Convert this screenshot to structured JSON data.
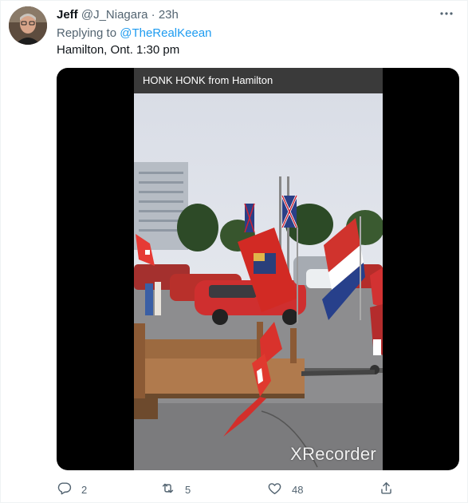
{
  "tweet": {
    "display_name": "Jeff",
    "handle": "@J_Niagara",
    "separator": "·",
    "time": "23h",
    "replying_prefix": "Replying to",
    "replying_to": "@TheRealKeean",
    "text": "Hamilton, Ont. 1:30 pm"
  },
  "media": {
    "video_title": "HONK HONK from Hamilton",
    "watermark": "XRecorder"
  },
  "actions": {
    "replies": "2",
    "retweets": "5",
    "likes": "48"
  },
  "colors": {
    "link": "#1d9bf0",
    "muted": "#536471",
    "text": "#0f1419"
  },
  "icons": [
    "more-icon",
    "reply-icon",
    "retweet-icon",
    "like-icon",
    "share-icon"
  ]
}
